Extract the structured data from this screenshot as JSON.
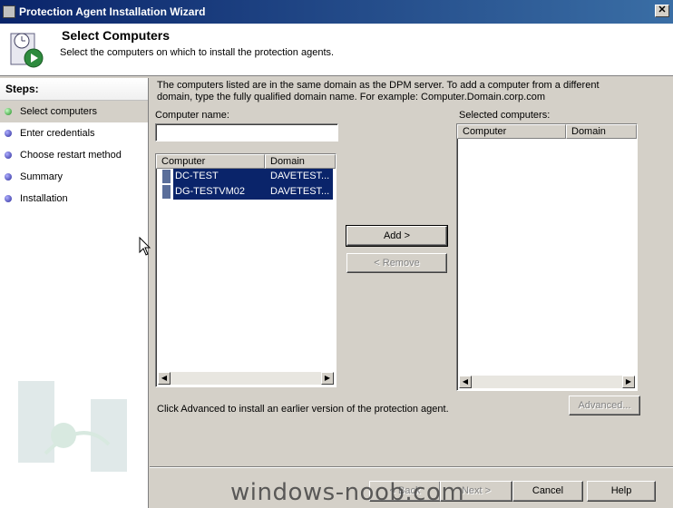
{
  "window": {
    "title": "Protection Agent Installation Wizard"
  },
  "header": {
    "title": "Select Computers",
    "subtitle": "Select the computers on which to install the protection agents."
  },
  "steps": {
    "label": "Steps:",
    "items": [
      {
        "label": "Select computers",
        "active": true
      },
      {
        "label": "Enter credentials",
        "active": false
      },
      {
        "label": "Choose restart method",
        "active": false
      },
      {
        "label": "Summary",
        "active": false
      },
      {
        "label": "Installation",
        "active": false
      }
    ]
  },
  "main": {
    "info": "The computers listed are in the same domain as the DPM server. To add a computer from a different domain, type the fully qualified domain name. For example: Computer.Domain.corp.com",
    "computer_name_label": "Computer name:",
    "computer_name_value": "",
    "available": {
      "columns": [
        "Computer",
        "Domain"
      ],
      "rows": [
        {
          "computer": "DC-TEST",
          "domain": "DAVETEST..."
        },
        {
          "computer": "DG-TESTVM02",
          "domain": "DAVETEST..."
        }
      ]
    },
    "selected_label": "Selected computers:",
    "selected": {
      "columns": [
        "Computer",
        "Domain"
      ],
      "rows": []
    },
    "add_button": "Add >",
    "remove_button": "< Remove",
    "advanced_note": "Click Advanced to install an earlier version of the protection agent.",
    "advanced_button": "Advanced..."
  },
  "footer": {
    "back_button": "< Back",
    "next_button": "Next >",
    "cancel_button": "Cancel",
    "help_button": "Help"
  },
  "watermark": "windows-noob.com"
}
